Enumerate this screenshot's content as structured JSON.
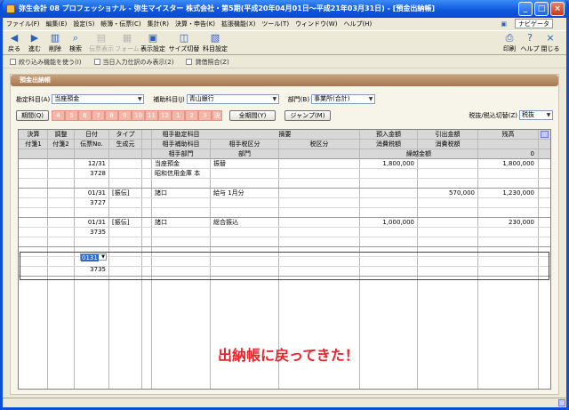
{
  "titlebar": {
    "title": "弥生会計 08 プロフェッショナル - 弥生マイスター 株式会社・第5期(平成20年04月01日～平成21年03月31日) - [預金出納帳]"
  },
  "menu": [
    "ファイル(F)",
    "編集(E)",
    "設定(S)",
    "帳簿・伝票(C)",
    "集計(R)",
    "決算・申告(K)",
    "拡張機能(X)",
    "ツール(T)",
    "ウィンドウ(W)",
    "ヘルプ(H)"
  ],
  "navi": "ナビゲータ",
  "toolbar": {
    "back": "戻る",
    "forward": "進む",
    "delete": "削除",
    "search": "検索",
    "voucher": "伝票表示",
    "form": "フォーム",
    "display": "表示設定",
    "size": "サイズ切替",
    "account": "科目設定",
    "print": "印刷",
    "help": "ヘルプ",
    "close": "閉じる"
  },
  "subbar": [
    "絞り込み機能を使う(I)",
    "当日入力仕訳のみ表示(2)",
    "貸借照合(Z)"
  ],
  "panel_title": "預金出納帳",
  "filters": {
    "account_label": "勘定科目(A)",
    "account": "当座預金",
    "subaccount_label": "補助科目(J)",
    "subaccount": "青山銀行",
    "dept_label": "部門(B)",
    "dept": "事業所(合計)"
  },
  "period_btn": "期間(Q)",
  "months": [
    "4",
    "5",
    "6",
    "7",
    "8",
    "9",
    "10",
    "11",
    "12",
    "1",
    "2",
    "3",
    "決"
  ],
  "all_period_btn": "全期間(Y)",
  "jump_btn": "ジャンプ(M)",
  "tax_label": "税抜/税込切替(Z)",
  "tax_value": "税抜",
  "headers": {
    "r1": [
      "決算",
      "調整",
      "日付",
      "タイプ",
      "相手勘定科目",
      "摘要",
      "預入金額",
      "引出金額",
      "残高"
    ],
    "r2": [
      "付箋1",
      "付箋2",
      "伝票No.",
      "生成元",
      "相手補助科目",
      "相手税区分",
      "税区分",
      "消費税額",
      "消費税額"
    ],
    "r3": [
      "相手部門",
      "部門",
      "繰越金額"
    ]
  },
  "carry_balance": "0",
  "rows": [
    {
      "date": "12/31",
      "no": "3728",
      "type": "",
      "acct": "当座預金",
      "sub": "昭和信用金庫 本",
      "memo": "振替",
      "deposit": "1,800,000",
      "withdraw": "",
      "balance": "1,800,000"
    },
    {
      "date": "01/31",
      "no": "3727",
      "type": "[振伝]",
      "acct": "諸口",
      "sub": "",
      "memo": "給与 1月分",
      "deposit": "",
      "withdraw": "570,000",
      "balance": "1,230,000"
    },
    {
      "date": "01/31",
      "no": "3735",
      "type": "[振伝]",
      "acct": "諸口",
      "sub": "",
      "memo": "総合振込",
      "deposit": "1,000,000",
      "withdraw": "",
      "balance": "230,000"
    }
  ],
  "edit_row": {
    "date": "0131",
    "no": "3735"
  },
  "message": "出納帳に戻ってきた！"
}
